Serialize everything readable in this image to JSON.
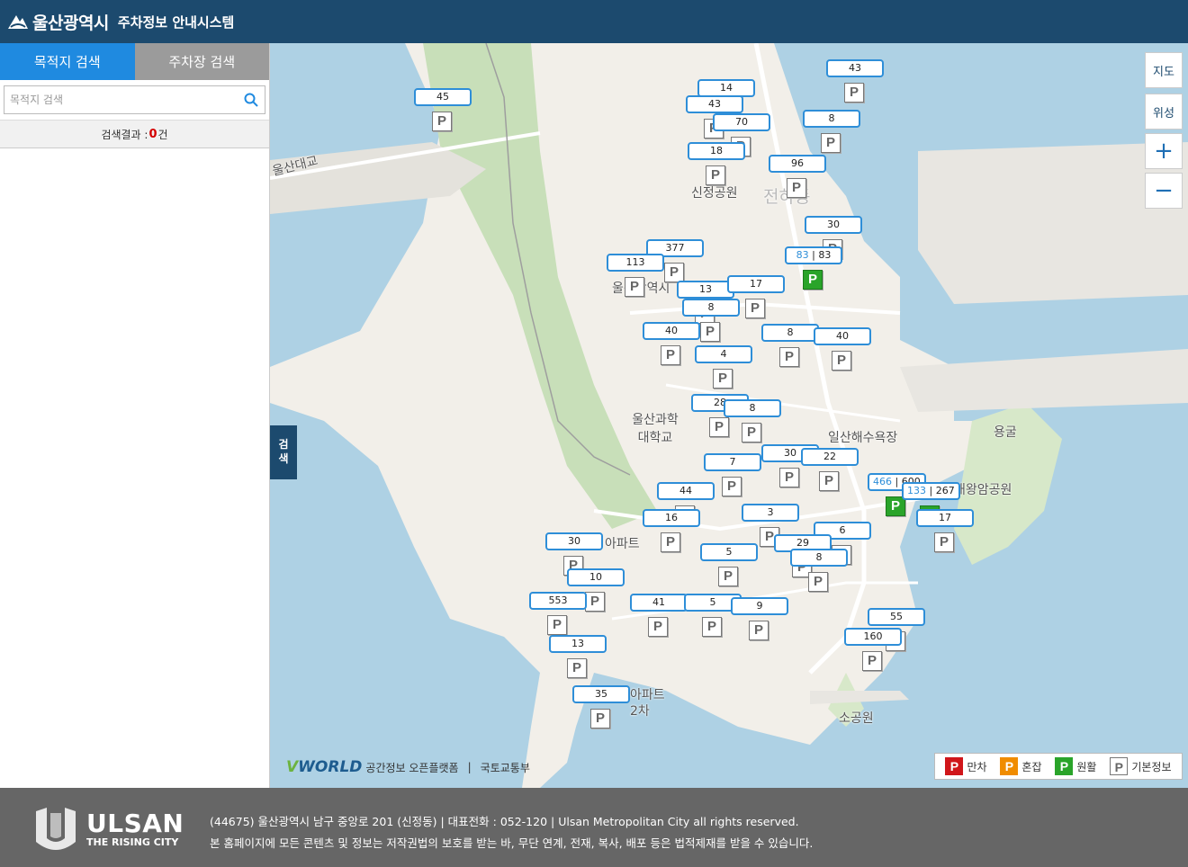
{
  "header": {
    "logo_text": "울산광역시",
    "title": "주차정보 안내시스템"
  },
  "sidebar": {
    "tabs": [
      {
        "label": "목적지 검색"
      },
      {
        "label": "주차장 검색"
      }
    ],
    "search_placeholder": "목적지 검색",
    "result_prefix": "검색결과 : ",
    "result_count": "0",
    "result_suffix": "건"
  },
  "map": {
    "search_toggle": [
      "검",
      "색"
    ],
    "controls": {
      "map_label": "지도",
      "satellite_label": "위성",
      "zoom_in": "+",
      "zoom_out": "−"
    },
    "places": [
      "울산대교",
      "신정공원",
      "울산광역시",
      "울산과학대학교",
      "아파트",
      "일산해수욕장",
      "용굴",
      "대왕암공원",
      "소공원",
      "2차",
      "전하동",
      "아파트"
    ],
    "parking_lots": [
      {
        "label": "45"
      },
      {
        "label": "14"
      },
      {
        "label": "43"
      },
      {
        "label": "70"
      },
      {
        "label": "18"
      },
      {
        "label": "43"
      },
      {
        "label": "8"
      },
      {
        "label": "96"
      },
      {
        "label": "30"
      },
      {
        "free": "83",
        "total": "83"
      },
      {
        "label": "377"
      },
      {
        "label": "113"
      },
      {
        "label": "13"
      },
      {
        "label": "17"
      },
      {
        "label": "8"
      },
      {
        "label": "40"
      },
      {
        "label": "8"
      },
      {
        "label": "40"
      },
      {
        "label": "4"
      },
      {
        "label": "28"
      },
      {
        "label": "8"
      },
      {
        "label": "30"
      },
      {
        "label": "22"
      },
      {
        "label": "7"
      },
      {
        "free": "466",
        "total": "600"
      },
      {
        "free": "133",
        "total": "267"
      },
      {
        "label": "44"
      },
      {
        "label": "17"
      },
      {
        "label": "16"
      },
      {
        "label": "3"
      },
      {
        "label": "6"
      },
      {
        "label": "30"
      },
      {
        "label": "29"
      },
      {
        "label": "5"
      },
      {
        "label": "8"
      },
      {
        "label": "10"
      },
      {
        "label": "553"
      },
      {
        "label": "41"
      },
      {
        "label": "5"
      },
      {
        "label": "9"
      },
      {
        "label": "55"
      },
      {
        "label": "160"
      },
      {
        "label": "13"
      },
      {
        "label": "35"
      }
    ],
    "attribution": "공간정보 오픈플랫폼",
    "attribution_sep": "|",
    "attribution2": "국토교통부",
    "legend": [
      {
        "label": "만차",
        "color": "#d0161a"
      },
      {
        "label": "혼잡",
        "color": "#f08c00"
      },
      {
        "label": "원활",
        "color": "#2aa42a"
      },
      {
        "label": "기본정보",
        "color": "#ffffff"
      }
    ]
  },
  "footer": {
    "brand": "ULSAN",
    "slogan": "THE RISING CITY",
    "line1": "(44675) 울산광역시 남구 중앙로 201 (신정동) | 대표전화 : 052-120 | Ulsan Metropolitan City all rights reserved.",
    "line2": "본 홈페이지에 모든 콘텐츠 및 정보는 저작권법의 보호를 받는 바, 무단 연계, 전재, 복사, 배포 등은 법적제재를 받을 수 있습니다."
  }
}
